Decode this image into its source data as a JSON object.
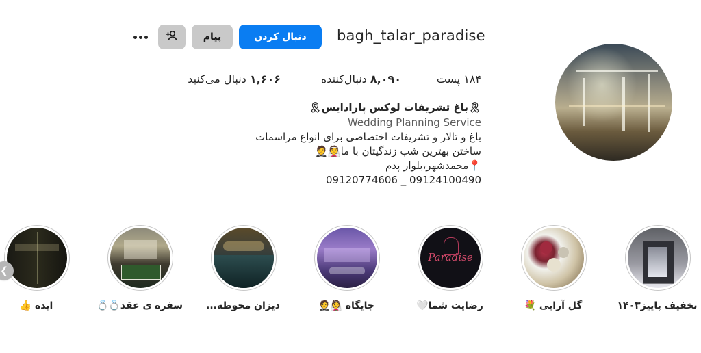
{
  "profile": {
    "username": "bagh_talar_paradise",
    "follow_label": "دنبال کردن",
    "message_label": "پیام",
    "add_user_icon": "add-user-icon",
    "more_icon": "more-icon"
  },
  "stats": {
    "posts": "۱۸۴ پست",
    "followers_count": "۸,۰۹۰",
    "followers_label": " دنبال‌کننده",
    "following_count": "۱,۶۰۶",
    "following_label": " دنبال می‌کنید"
  },
  "bio": {
    "name": "🎗باغ تشریفات لوکس پارادایس🎗",
    "category": "Wedding Planning Service",
    "line1": "باغ و تالار و تشریفات اختصاصی برای انواع مراسمات",
    "line2": "ساختن بهترین شب زندگیتان با ما👰🤵",
    "line3": "📍محمدشهر،بلوار پدم",
    "phones": "09120774606 _ 09124100490"
  },
  "highlights": [
    {
      "label": "تخفیف پاییز۱۴۰۳"
    },
    {
      "label": "گل آرایی 💐"
    },
    {
      "label": "رضایت شما🤍"
    },
    {
      "label": "جایگاه 👰🤵"
    },
    {
      "label": "دیزان محوطه..."
    },
    {
      "label": "سفره ی عقد💍💍"
    },
    {
      "label": "ایده 👍"
    }
  ],
  "highlight_texts": {
    "paradise_logo": "Paradise"
  },
  "colors": {
    "accent": "#0a7df2",
    "secondary_button": "#c9c9c9",
    "text": "#262626"
  }
}
